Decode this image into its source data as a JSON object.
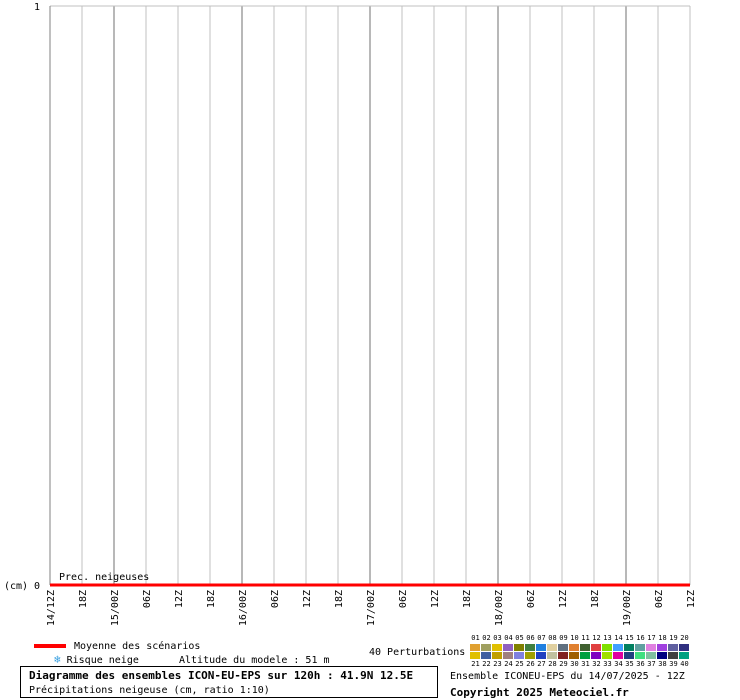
{
  "chart_data": {
    "type": "line",
    "y_axis_unit": "(cm)",
    "y_ticks": [
      0,
      1
    ],
    "ylim": [
      0,
      1
    ],
    "x_tick_labels": [
      "14/12Z",
      "18Z",
      "15/00Z",
      "06Z",
      "12Z",
      "18Z",
      "16/00Z",
      "06Z",
      "12Z",
      "18Z",
      "17/00Z",
      "06Z",
      "12Z",
      "18Z",
      "18/00Z",
      "06Z",
      "12Z",
      "18Z",
      "19/00Z",
      "06Z",
      "12Z"
    ],
    "series_label": "Prec. neigeuses",
    "series": [
      {
        "name": "Moyenne des scénarios",
        "color": "#ff0000",
        "values": [
          0,
          0,
          0,
          0,
          0,
          0,
          0,
          0,
          0,
          0,
          0,
          0,
          0,
          0,
          0,
          0,
          0,
          0,
          0,
          0,
          0
        ]
      }
    ],
    "grid": true
  },
  "legend": {
    "mean_label": "Moyenne des scénarios",
    "snow_risk_label": "Risque neige",
    "altitude_label": "Altitude du modele : 51 m",
    "perturbations_label": "40 Perturbations"
  },
  "perturbations": {
    "top_numbers": [
      "01",
      "02",
      "03",
      "04",
      "05",
      "06",
      "07",
      "08",
      "09",
      "10",
      "11",
      "12",
      "13",
      "14",
      "15",
      "16",
      "17",
      "18",
      "19",
      "20"
    ],
    "bottom_numbers": [
      "21",
      "22",
      "23",
      "24",
      "25",
      "26",
      "27",
      "28",
      "29",
      "30",
      "31",
      "32",
      "33",
      "34",
      "35",
      "36",
      "37",
      "38",
      "39",
      "40"
    ],
    "top_colors": [
      "#e0a030",
      "#a0a060",
      "#e0c000",
      "#9060c0",
      "#808000",
      "#408040",
      "#2080e0",
      "#e0d0a0",
      "#607080",
      "#e08030",
      "#406030",
      "#e04040",
      "#80e000",
      "#40a0ff",
      "#008060",
      "#60a0a0",
      "#e080e0",
      "#a040e0",
      "#6060a0",
      "#303080"
    ],
    "bottom_colors": [
      "#e0c000",
      "#4060a0",
      "#c0a000",
      "#a08080",
      "#8080e0",
      "#a0a000",
      "#2040c0",
      "#c0c0a0",
      "#802020",
      "#a06000",
      "#00a040",
      "#8000c0",
      "#a0e000",
      "#e000a0",
      "#204080",
      "#40e080",
      "#80c0a0",
      "#000080",
      "#404040",
      "#00a080"
    ]
  },
  "footer": {
    "title": "Diagramme des ensembles ICON-EU-EPS sur 120h : 41.9N 12.5E",
    "subtitle": "Précipitations neigeuse (cm, ratio 1:10)",
    "ensemble": "Ensemble ICONEU-EPS du 14/07/2025 - 12Z",
    "copyright": "Copyright 2025 Meteociel.fr"
  }
}
